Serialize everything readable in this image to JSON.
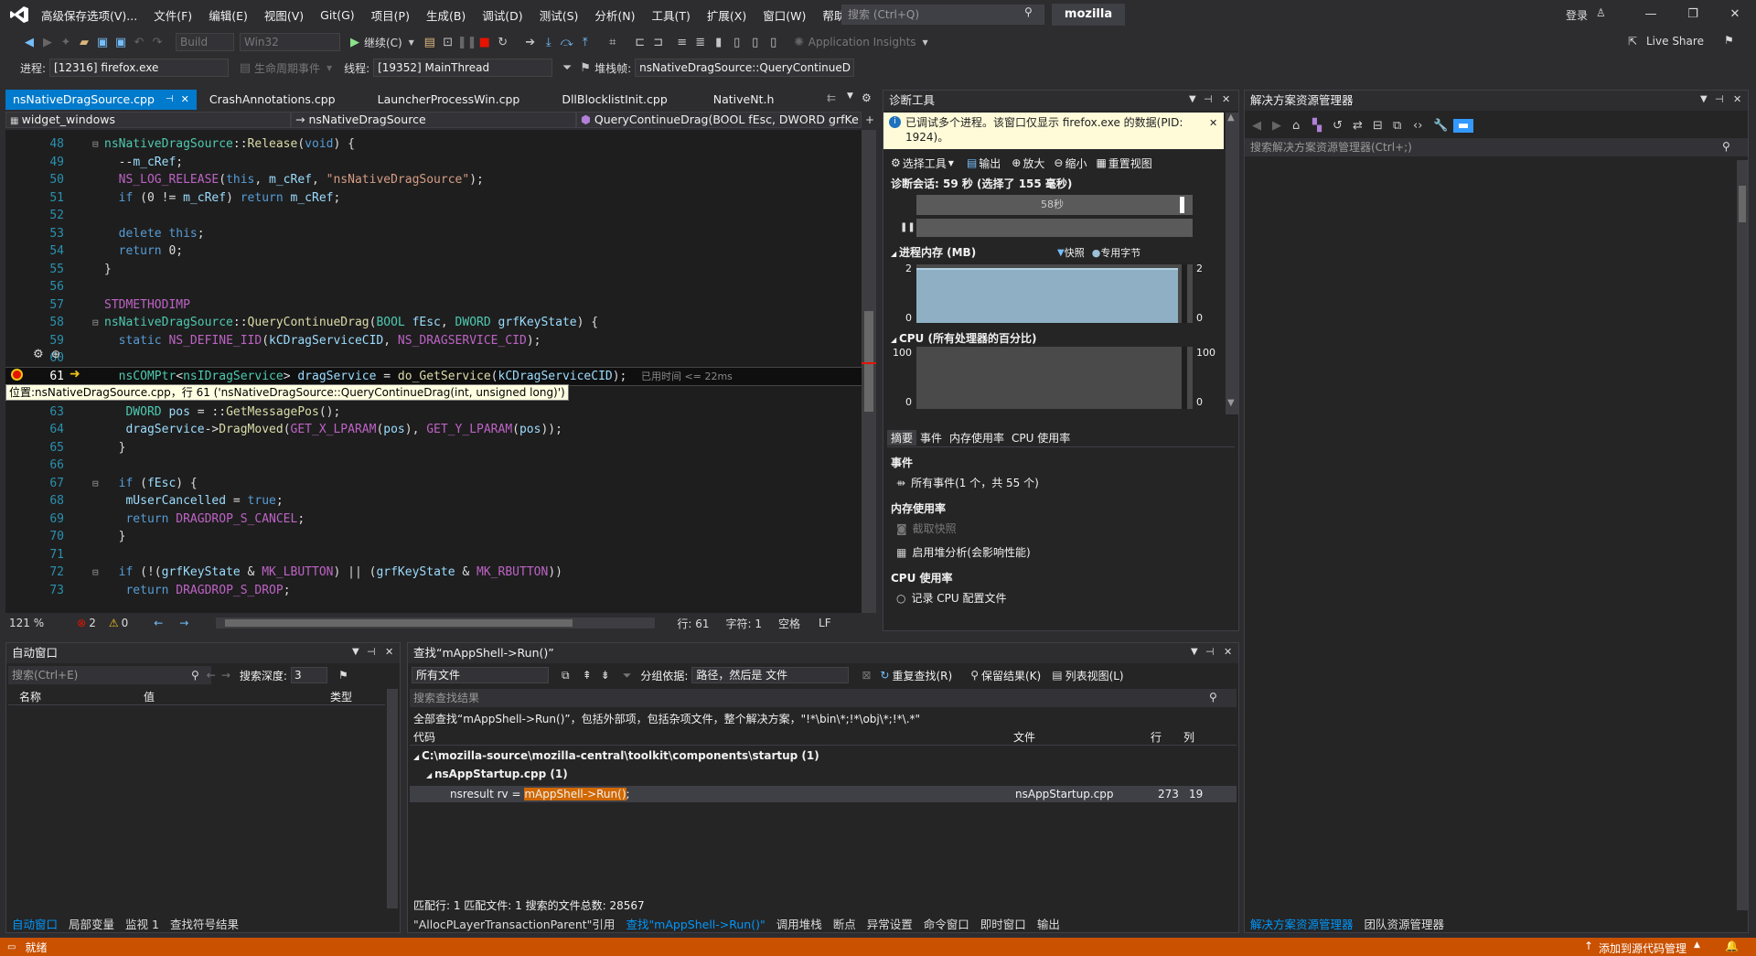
{
  "menu": {
    "items": [
      "高级保存选项(V)...",
      "文件(F)",
      "编辑(E)",
      "视图(V)",
      "Git(G)",
      "项目(P)",
      "生成(B)",
      "调试(D)",
      "测试(S)",
      "分析(N)",
      "工具(T)",
      "扩展(X)",
      "窗口(W)",
      "帮助(H)"
    ],
    "search_placeholder": "搜索 (Ctrl+Q)",
    "solution_name": "mozilla",
    "login": "登录"
  },
  "toolbar": {
    "config": "Build",
    "platform": "Win32",
    "continue": "继续(C)",
    "app_insights": "Application Insights",
    "live_share": "Live Share",
    "process_label": "进程:",
    "process": "[12316] firefox.exe",
    "lifecycle": "生命周期事件",
    "thread_label": "线程:",
    "thread": "[19352] MainThread",
    "stack_label": "堆栈帧:",
    "stack": "nsNativeDragSource::QueryContinueD"
  },
  "editor": {
    "tabs": [
      "nsNativeDragSource.cpp",
      "CrashAnnotations.cpp",
      "LauncherProcessWin.cpp",
      "DllBlocklistInit.cpp",
      "NativeNt.h"
    ],
    "nav_scope": "widget_windows",
    "nav_class": "nsNativeDragSource",
    "nav_member": "QueryContinueDrag(BOOL fEsc, DWORD grfKe",
    "elapsed": "已用时间 <= 22ms",
    "tooltip": "位置:nsNativeDragSource.cpp，行 61 ('nsNativeDragSource::QueryContinueDrag(int, unsigned long)')",
    "zoom": "121 %",
    "errors": "2",
    "warnings": "0",
    "line": "行: 61",
    "col": "字符: 1",
    "ws": "空格",
    "eol": "LF"
  },
  "diag": {
    "title": "诊断工具",
    "info": "已调试多个进程。该窗口仅显示 firefox.exe 的数据(PID: 1924)。",
    "select_tool": "选择工具",
    "output": "输出",
    "zoom_in": "放大",
    "zoom_out": "缩小",
    "reset": "重置视图",
    "session": "诊断会话: 59 秒 (选择了 155 毫秒)",
    "timeline": "58秒",
    "mem_title": "进程内存 (MB)",
    "snapshot": "快照",
    "private": "专用字节",
    "mem_max": "2",
    "mem_min": "0",
    "cpu_title": "CPU (所有处理器的百分比)",
    "cpu_max": "100",
    "cpu_min": "0",
    "tabs": [
      "摘要",
      "事件",
      "内存使用率",
      "CPU 使用率"
    ],
    "events_title": "事件",
    "events": "所有事件(1 个，共 55 个)",
    "memuse_title": "内存使用率",
    "take_snapshot": "截取快照",
    "heap": "启用堆分析(会影响性能)",
    "cpuuse_title": "CPU 使用率",
    "cpu_profile": "记录 CPU 配置文件"
  },
  "solution": {
    "title": "解决方案资源管理器",
    "search": "搜索解决方案资源管理器(Ctrl+;)",
    "tabs": [
      "解决方案资源管理器",
      "团队资源管理器"
    ]
  },
  "auto": {
    "title": "自动窗口",
    "search": "搜索(Ctrl+E)",
    "depth_label": "搜索深度:",
    "depth": "3",
    "cols": [
      "名称",
      "值",
      "类型"
    ],
    "tabs": [
      "自动窗口",
      "局部变量",
      "监视 1",
      "查找符号结果"
    ]
  },
  "find": {
    "title": "查找“mAppShell->Run()”",
    "scope": "所有文件",
    "group_label": "分组依据:",
    "group": "路径，然后是 文件",
    "refind": "重复查找(R)",
    "keep": "保留结果(K)",
    "listview": "列表视图(L)",
    "search_ph": "搜索查找结果",
    "summary": "全部查找“mAppShell->Run()”，包括外部项，包括杂项文件，整个解决方案，\"!*\\bin\\*;!*\\obj\\*;!*\\.*\"",
    "cols": [
      "代码",
      "文件",
      "行",
      "列"
    ],
    "dir": "C:\\mozilla-source\\mozilla-central\\toolkit\\components\\startup (1)",
    "file": "nsAppStartup.cpp (1)",
    "result_pre": "nsresult rv = ",
    "result_hl": "mAppShell->Run()",
    "result_post": ";",
    "result_file": "nsAppStartup.cpp",
    "result_line": "273",
    "result_col": "19",
    "footer": "匹配行: 1 匹配文件: 1 搜索的文件总数: 28567",
    "tabs": [
      "\"AllocPLayerTransactionParent\"引用",
      "查找\"mAppShell->Run()\"",
      "调用堆栈",
      "断点",
      "异常设置",
      "命令窗口",
      "即时窗口",
      "输出"
    ]
  },
  "status": {
    "ready": "就绪",
    "source": "添加到源代码管理"
  }
}
